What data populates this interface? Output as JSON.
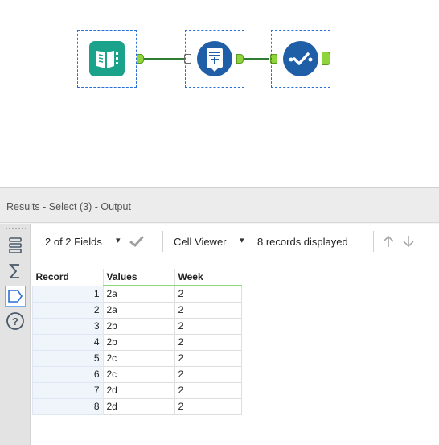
{
  "workflow": {
    "tools": [
      {
        "name": "Input Data",
        "icon": "book-input-icon",
        "color": "#1aa38a"
      },
      {
        "name": "Select",
        "icon": "select-list-icon",
        "color": "#1f5fa8"
      },
      {
        "name": "Browse",
        "icon": "browse-check-icon",
        "color": "#1f5fa8"
      }
    ]
  },
  "results": {
    "title": "Results - Select (3) - Output",
    "sidebar": {
      "items": [
        {
          "icon": "table-rows-icon"
        },
        {
          "icon": "sigma-icon"
        },
        {
          "icon": "tag-icon"
        },
        {
          "icon": "help-icon"
        }
      ]
    },
    "toolbar": {
      "fields_label": "2 of 2 Fields",
      "fields_caret": "▾",
      "check_icon": "checkmark-icon",
      "cell_viewer_label": "Cell Viewer",
      "cell_viewer_caret": "▾",
      "records_label": "8 records displayed",
      "up_icon": "arrow-up-icon",
      "down_icon": "arrow-down-icon"
    },
    "table": {
      "columns": [
        "Record",
        "Values",
        "Week"
      ],
      "rows": [
        [
          "1",
          "2a",
          "2"
        ],
        [
          "2",
          "2a",
          "2"
        ],
        [
          "3",
          "2b",
          "2"
        ],
        [
          "4",
          "2b",
          "2"
        ],
        [
          "5",
          "2c",
          "2"
        ],
        [
          "6",
          "2c",
          "2"
        ],
        [
          "7",
          "2d",
          "2"
        ],
        [
          "8",
          "2d",
          "2"
        ]
      ]
    }
  }
}
